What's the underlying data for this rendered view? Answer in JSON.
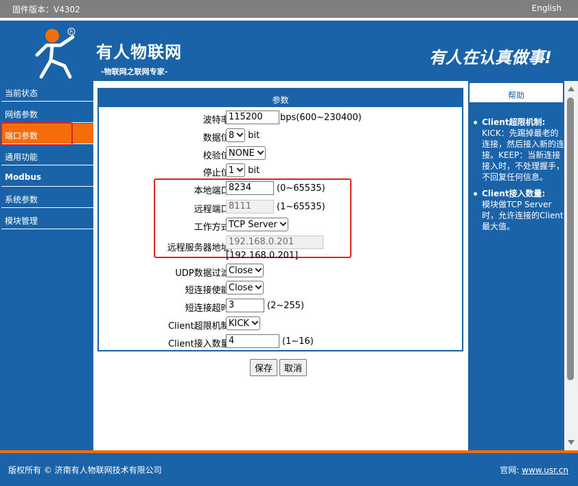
{
  "topbar": {
    "firmware": "固件版本：V4302",
    "language": "English"
  },
  "header": {
    "brand": "有人物联网",
    "tagline": "-物联网之联网专家-",
    "slogan": "有人在认真做事!"
  },
  "nav": {
    "items": [
      "当前状态",
      "网络参数",
      "端口参数",
      "通用功能",
      "Modbus",
      "系统参数",
      "模块管理"
    ],
    "active": "端口参数"
  },
  "panel": {
    "title": "参数",
    "baud": {
      "label": "波特率:",
      "value": "115200",
      "hint": "bps(600~230400)"
    },
    "databits": {
      "label": "数据位:",
      "value": "8",
      "unit": "bit"
    },
    "parity": {
      "label": "校验位:",
      "value": "NONE"
    },
    "stopbits": {
      "label": "停止位:",
      "value": "1",
      "unit": "bit"
    },
    "local_port": {
      "label": "本地端口:",
      "value": "8234",
      "hint": "(0~65535)"
    },
    "remote_port": {
      "label": "远程端口:",
      "value": "8111",
      "hint": "(1~65535)"
    },
    "work_mode": {
      "label": "工作方式:",
      "value": "TCP Server"
    },
    "remote_addr": {
      "label": "远程服务器地址:",
      "value": "192.168.0.201",
      "echo": "[192.168.0.201]"
    },
    "udp_filter": {
      "label": "UDP数据过滤:",
      "value": "Close"
    },
    "short_conn": {
      "label": "短连接使能:",
      "value": "Close"
    },
    "short_timeout": {
      "label": "短连接超时:",
      "value": "3",
      "hint": "(2~255)"
    },
    "client_limit": {
      "label": "Client超限机制:",
      "value": "KICK"
    },
    "client_count": {
      "label": "Client接入数量:",
      "value": "4",
      "hint": "(1~16)"
    }
  },
  "buttons": {
    "save": "保存",
    "cancel": "取消"
  },
  "help": {
    "title": "帮助",
    "items": [
      {
        "heading": "Client超限机制:",
        "text": "KICK：先踢掉最老的连接，然后接入新的连接。KEEP：当新连接接入时，不处理握手，不回复任何信息。"
      },
      {
        "heading": "Client接入数量:",
        "text": "模块做TCP Server时，允许连接的Client最大值。"
      }
    ]
  },
  "footer": {
    "copyright": "版权所有 © 济南有人物联网技术有限公司",
    "site_label": "官网:",
    "site_url": "www.usr.cn"
  },
  "colors": {
    "brand_blue": "#1a63a8",
    "accent_orange": "#f36d0a",
    "highlight_red": "#e02020"
  }
}
